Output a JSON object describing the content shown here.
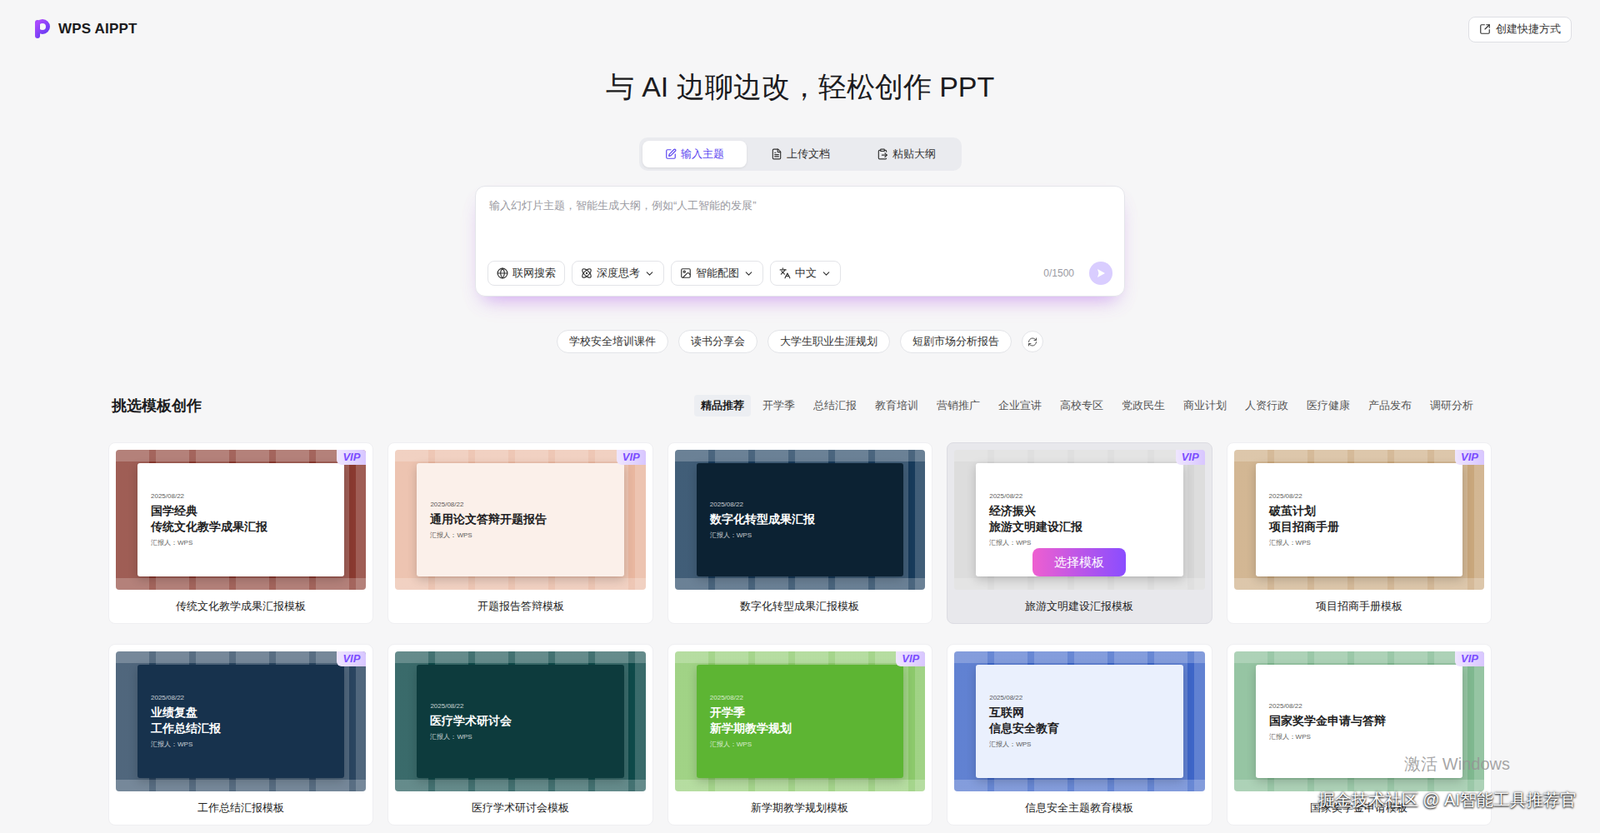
{
  "app": {
    "name": "WPS AIPPT"
  },
  "shortcut_button": "创建快捷方式",
  "headline": "与 AI 边聊边改，轻松创作 PPT",
  "input_modes": [
    {
      "label": "输入主题",
      "kind": "topic",
      "selected": true
    },
    {
      "label": "上传文档",
      "kind": "upload",
      "selected": false
    },
    {
      "label": "粘贴大纲",
      "kind": "paste",
      "selected": false
    }
  ],
  "prompt": {
    "placeholder": "输入幻灯片主题，智能生成大纲，例如“人工智能的发展”",
    "counter": "0/1500",
    "send_enabled": false,
    "options": [
      {
        "label": "联网搜索",
        "kind": "web",
        "dropdown": false
      },
      {
        "label": "深度思考",
        "kind": "think",
        "dropdown": true
      },
      {
        "label": "智能配图",
        "kind": "image",
        "dropdown": true
      },
      {
        "label": "中文",
        "kind": "lang",
        "dropdown": true
      }
    ]
  },
  "suggestions": [
    "学校安全培训课件",
    "读书分享会",
    "大学生职业生涯规划",
    "短剧市场分析报告"
  ],
  "templates": {
    "title": "挑选模板创作",
    "hover_button": "选择模板",
    "categories": [
      {
        "label": "精品推荐",
        "selected": true
      },
      {
        "label": "开学季",
        "selected": false
      },
      {
        "label": "总结汇报",
        "selected": false
      },
      {
        "label": "教育培训",
        "selected": false
      },
      {
        "label": "营销推广",
        "selected": false
      },
      {
        "label": "企业宣讲",
        "selected": false
      },
      {
        "label": "高校专区",
        "selected": false
      },
      {
        "label": "党政民生",
        "selected": false
      },
      {
        "label": "商业计划",
        "selected": false
      },
      {
        "label": "人资行政",
        "selected": false
      },
      {
        "label": "医疗健康",
        "selected": false
      },
      {
        "label": "产品发布",
        "selected": false
      },
      {
        "label": "调研分析",
        "selected": false
      }
    ],
    "cards": [
      {
        "caption": "传统文化教学成果汇报模板",
        "vip": true,
        "hovered": false,
        "color": "#8a3a30",
        "slide": {
          "color": "#ffffff",
          "title": [
            "国学经典",
            "传统文化教学成果汇报"
          ],
          "date": "2025/08/22",
          "presenter": "汇报人：WPS"
        }
      },
      {
        "caption": "开题报告答辩模板",
        "vip": true,
        "hovered": false,
        "color": "#e9b7a0",
        "slide": {
          "color": "#fbf0ea",
          "title": [
            "通用论文答辩开题报告"
          ],
          "date": "2025/08/22",
          "presenter": "汇报人：WPS"
        }
      },
      {
        "caption": "数字化转型成果汇报模板",
        "vip": false,
        "hovered": false,
        "color": "#173a5a",
        "slide": {
          "color": "#0c2233",
          "title": [
            "数字化转型成果汇报"
          ],
          "date": "2025/08/22",
          "presenter": "汇报人：WPS"
        }
      },
      {
        "caption": "旅游文明建设汇报模板",
        "vip": true,
        "hovered": true,
        "color": "#d6d6d6",
        "slide": {
          "color": "#ffffff",
          "title": [
            "经济振兴",
            "旅游文明建设汇报"
          ],
          "date": "2025/08/22",
          "presenter": "汇报人：WPS"
        }
      },
      {
        "caption": "项目招商手册模板",
        "vip": true,
        "hovered": false,
        "color": "#c9a77c",
        "slide": {
          "color": "#ffffff",
          "title": [
            "破茧计划",
            "项目招商手册"
          ],
          "date": "2025/08/22",
          "presenter": "汇报人：WPS"
        }
      },
      {
        "caption": "工作总结汇报模板",
        "vip": true,
        "hovered": false,
        "color": "#2a4560",
        "slide": {
          "color": "#17324d",
          "title": [
            "业绩复盘",
            "工作总结汇报"
          ],
          "date": "2025/08/22",
          "presenter": "汇报人：WPS"
        }
      },
      {
        "caption": "医疗学术研讨会模板",
        "vip": false,
        "hovered": false,
        "color": "#0f4a4a",
        "slide": {
          "color": "#0d3b3d",
          "title": [
            "医疗学术研讨会"
          ],
          "date": "2025/08/22",
          "presenter": "汇报人：WPS"
        }
      },
      {
        "caption": "新学期教学规划模板",
        "vip": true,
        "hovered": false,
        "color": "#8cc96b",
        "slide": {
          "color": "#5db533",
          "title": [
            "开学季",
            "新学期教学规划"
          ],
          "date": "2025/08/22",
          "presenter": "汇报人：WPS"
        }
      },
      {
        "caption": "信息安全主题教育模板",
        "vip": false,
        "hovered": false,
        "color": "#3e66c8",
        "slide": {
          "color": "#eaf0fd",
          "title": [
            "互联网",
            "信息安全教育"
          ],
          "date": "2025/08/22",
          "presenter": "汇报人：WPS"
        }
      },
      {
        "caption": "国家奖学金申请模板",
        "vip": true,
        "hovered": false,
        "color": "#7fb88f",
        "slide": {
          "color": "#ffffff",
          "title": [
            "国家奖学金申请与答辩"
          ],
          "date": "2025/08/22",
          "presenter": "汇报人：WPS"
        }
      }
    ]
  },
  "watermark": {
    "system": "激活 Windows",
    "credit": "掘金技术社区 @ AI智能工具推荐官"
  }
}
